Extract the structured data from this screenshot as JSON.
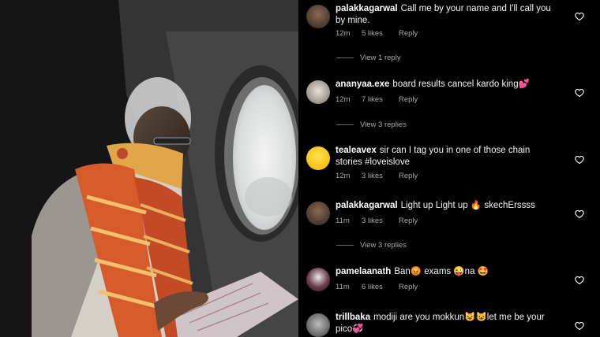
{
  "photo": {
    "description_icon": "photo"
  },
  "comments": [
    {
      "user": "palakkagarwal",
      "text": "Call me by your name and I'll call you by mine.",
      "time": "12m",
      "likes": "5 likes",
      "reply": "Reply",
      "replies": "View 1 reply"
    },
    {
      "user": "ananyaa.exe",
      "text": "board results cancel kardo king💕",
      "time": "12m",
      "likes": "7 likes",
      "reply": "Reply",
      "replies": "View 3 replies"
    },
    {
      "user": "tealeavex",
      "text": "sir can I tag you in one of those chain stories #loveislove",
      "time": "12m",
      "likes": "3 likes",
      "reply": "Reply",
      "replies": ""
    },
    {
      "user": "palakkagarwal",
      "text": "Light up Light up 🔥 skechErssss",
      "time": "11m",
      "likes": "3 likes",
      "reply": "Reply",
      "replies": "View 3 replies"
    },
    {
      "user": "pamelaanath",
      "text": "Ban😡 exams 😜na 🤩",
      "time": "11m",
      "likes": "6 likes",
      "reply": "Reply",
      "replies": ""
    },
    {
      "user": "trillbaka",
      "text": "modiji are you mokkun😺😺let me be your pico💞",
      "time": "",
      "likes": "",
      "reply": "",
      "replies": ""
    }
  ]
}
